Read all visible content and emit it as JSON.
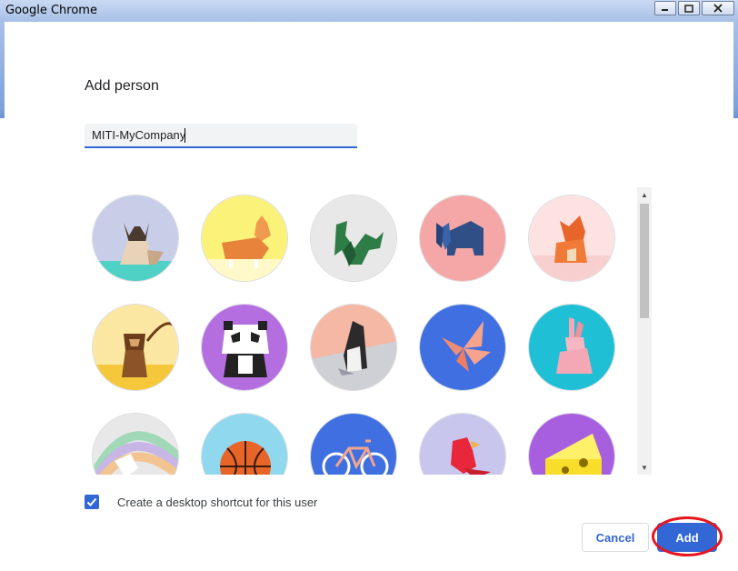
{
  "window": {
    "title": "Google Chrome",
    "controls": [
      "minimize",
      "maximize",
      "close"
    ]
  },
  "dialog": {
    "heading": "Add person",
    "name_input": {
      "value": "MITI-MyCompany"
    },
    "avatars": [
      {
        "name": "cat-avatar",
        "bg": "#c8cde8"
      },
      {
        "name": "corgi-avatar",
        "bg": "#fbf27a"
      },
      {
        "name": "dragon-avatar",
        "bg": "#e8e8e8"
      },
      {
        "name": "elephant-avatar",
        "bg": "#f5a6a6"
      },
      {
        "name": "fox-avatar",
        "bg": "#fde2e2"
      },
      {
        "name": "monkey-avatar",
        "bg": "#fbe7a1"
      },
      {
        "name": "panda-avatar",
        "bg": "#b46ee0"
      },
      {
        "name": "penguin-avatar",
        "bg": "#f4b8a4"
      },
      {
        "name": "butterfly-avatar",
        "bg": "#3f6fe0"
      },
      {
        "name": "rabbit-avatar",
        "bg": "#1fbfd6"
      },
      {
        "name": "unicorn-avatar",
        "bg": "#e8e8e8"
      },
      {
        "name": "basketball-avatar",
        "bg": "#8fd8ee"
      },
      {
        "name": "bicycle-avatar",
        "bg": "#3f6fe0"
      },
      {
        "name": "bird-avatar",
        "bg": "#c9c6ee"
      },
      {
        "name": "cheese-avatar",
        "bg": "#a75fe0"
      }
    ],
    "shortcut": {
      "checked": true,
      "label": "Create a desktop shortcut for this user"
    },
    "buttons": {
      "cancel": "Cancel",
      "add": "Add"
    }
  },
  "colors": {
    "accent": "#3367d6",
    "annotation": "#e8141e"
  }
}
